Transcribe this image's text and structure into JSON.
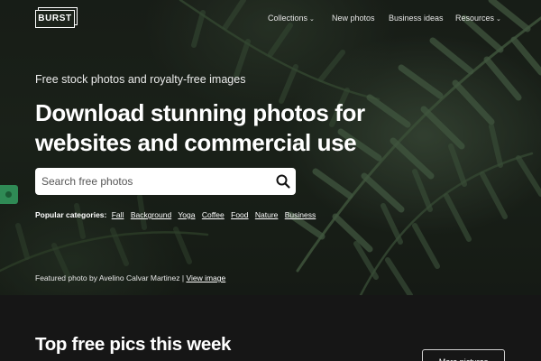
{
  "brand": {
    "logo_text": "BURST"
  },
  "nav": {
    "collections": "Collections",
    "new_photos": "New photos",
    "business_ideas": "Business ideas",
    "resources": "Resources"
  },
  "hero": {
    "tagline": "Free stock photos and royalty-free images",
    "headline": "Download stunning photos for websites and commercial use"
  },
  "search": {
    "placeholder": "Search free photos",
    "value": ""
  },
  "categories": {
    "label": "Popular categories:",
    "items": [
      "Fall",
      "Background",
      "Yoga",
      "Coffee",
      "Food",
      "Nature",
      "Business"
    ]
  },
  "credit": {
    "text": "Featured photo by Avelino Calvar Martinez |",
    "link": "View image"
  },
  "section": {
    "title": "Top free pics this week",
    "more_button": "More pictures"
  },
  "colors": {
    "side_tab": "#2f8a55",
    "background": "#161616"
  },
  "icons": [
    "search-icon",
    "chevron-down-icon",
    "chevron-down-icon"
  ]
}
